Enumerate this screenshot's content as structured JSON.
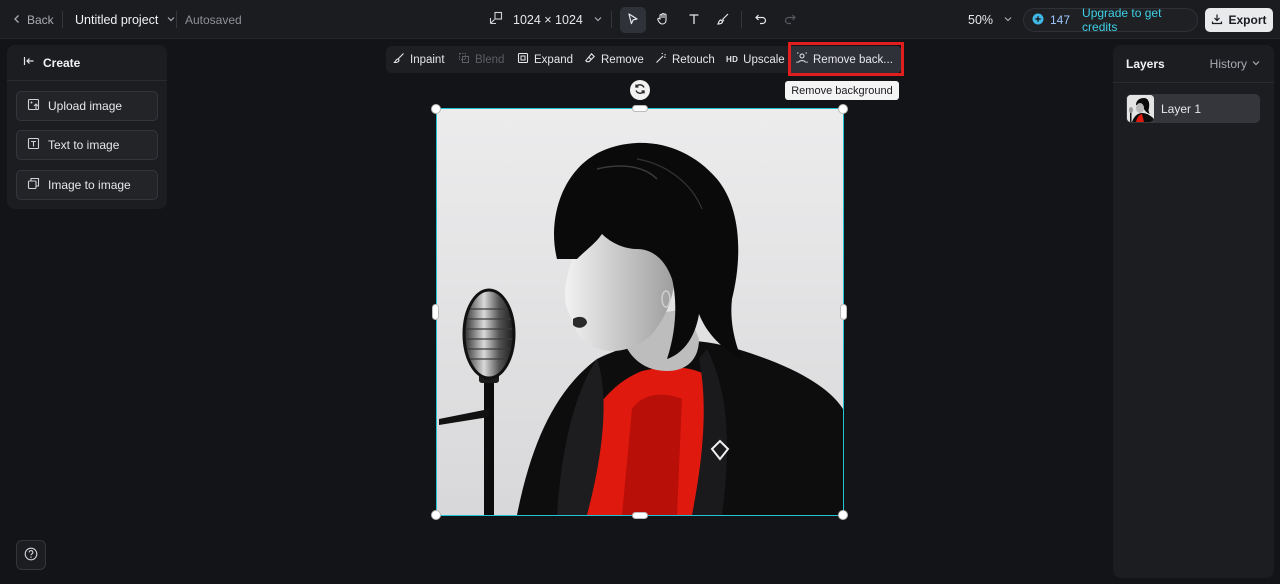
{
  "topbar": {
    "back_label": "Back",
    "project_name": "Untitled project",
    "autosaved": "Autosaved",
    "canvas_size": "1024 × 1024",
    "zoom": "50%",
    "credits_count": "147",
    "upgrade_label": "Upgrade to get credits",
    "export_label": "Export"
  },
  "left_panel": {
    "title": "Create",
    "buttons": [
      {
        "label": "Upload image"
      },
      {
        "label": "Text to image"
      },
      {
        "label": "Image to image"
      }
    ]
  },
  "context_toolbar": {
    "items": [
      {
        "label": "Inpaint",
        "icon": "inpaint-icon"
      },
      {
        "label": "Blend",
        "icon": "blend-icon",
        "disabled": true
      },
      {
        "label": "Expand",
        "icon": "expand-icon"
      },
      {
        "label": "Remove",
        "icon": "eraser-icon"
      },
      {
        "label": "Retouch",
        "icon": "retouch-icon"
      },
      {
        "label": "Upscale",
        "icon": "hd-icon"
      },
      {
        "label": "Remove back...",
        "icon": "remove-background-icon"
      }
    ],
    "tooltip": "Remove background",
    "hd_badge": "HD"
  },
  "right_panel": {
    "title": "Layers",
    "history_label": "History",
    "layers": [
      {
        "name": "Layer 1"
      }
    ]
  },
  "colors": {
    "accent": "#22c3d6",
    "highlight_box": "#e01e1e",
    "background": "#131418"
  }
}
